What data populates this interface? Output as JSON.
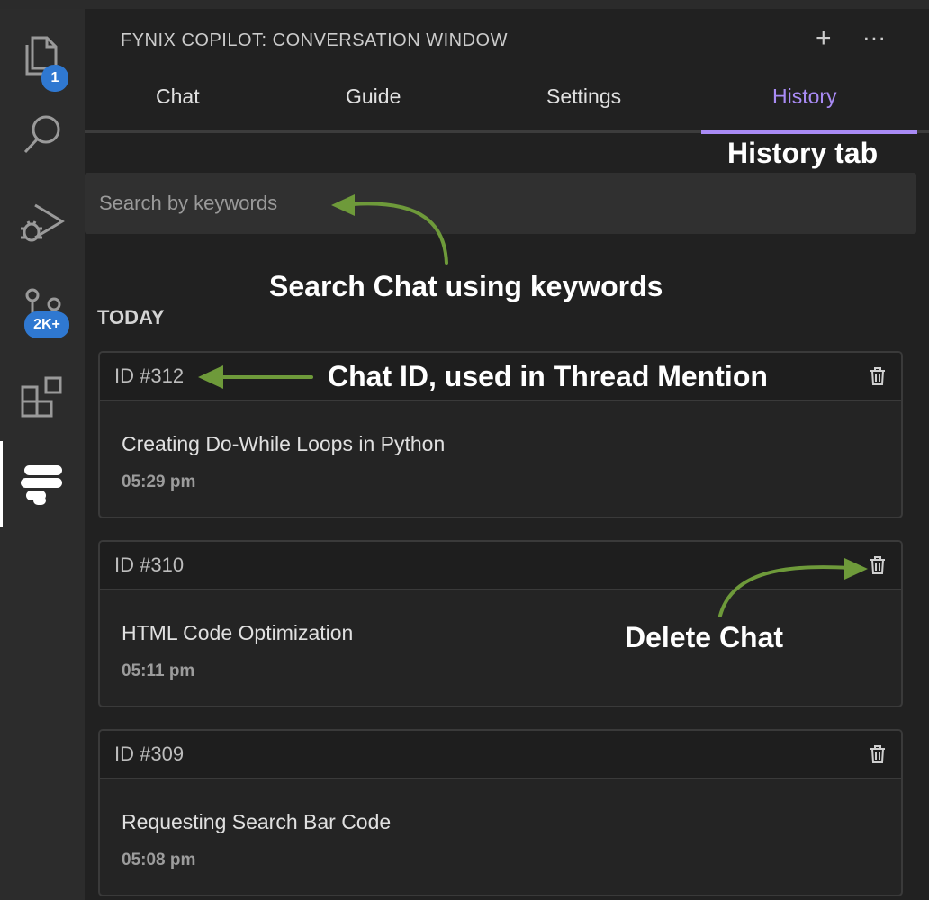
{
  "activity_bar": {
    "explorer_badge": "1",
    "source_control_badge": "2K+"
  },
  "panel": {
    "title": "FYNIX COPILOT: CONVERSATION WINDOW",
    "new_label": "+",
    "more_label": "···"
  },
  "tabs": [
    {
      "label": "Chat"
    },
    {
      "label": "Guide"
    },
    {
      "label": "Settings"
    },
    {
      "label": "History"
    }
  ],
  "active_tab": "History",
  "search": {
    "placeholder": "Search by keywords",
    "value": ""
  },
  "section_label": "TODAY",
  "chats": [
    {
      "id": "ID #312",
      "title": "Creating Do-While Loops in Python",
      "time": "05:29 pm"
    },
    {
      "id": "ID #310",
      "title": "HTML Code Optimization",
      "time": "05:11 pm"
    },
    {
      "id": "ID #309",
      "title": "Requesting Search Bar Code",
      "time": "05:08 pm"
    }
  ],
  "annotations": {
    "history_tab": "History tab",
    "search_chat": "Search Chat using keywords",
    "chat_id": "Chat ID, used in Thread Mention",
    "delete_chat": "Delete Chat"
  },
  "colors": {
    "accent": "#a98bf5",
    "annotation_arrow": "#6e9a3a",
    "badge": "#2f78d1"
  }
}
